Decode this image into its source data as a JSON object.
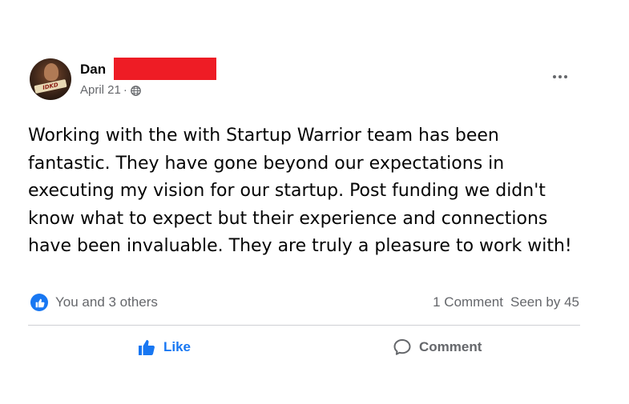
{
  "post": {
    "author_first": "Dan",
    "date": "April 21",
    "separator": "·",
    "audience_icon": "globe-icon",
    "body": "Working with the with Startup Warrior team has been\nfantastic. They have gone beyond our expectations in\nexecuting my vision for our startup. Post funding we didn't\nknow what to expect but their experience and connections\nhave been invaluable. They are truly a pleasure to work with!",
    "avatar_text": "IDKD"
  },
  "reactions": {
    "icon": "thumbs-up-icon",
    "summary": "You and 3 others"
  },
  "stats": {
    "comments": "1 Comment",
    "seen": "Seen by 45"
  },
  "actions": {
    "like_label": "Like",
    "comment_label": "Comment"
  },
  "colors": {
    "accent": "#1877f2",
    "secondary_text": "#65676b",
    "redaction": "#ee1c25",
    "divider": "#ced0d4"
  }
}
